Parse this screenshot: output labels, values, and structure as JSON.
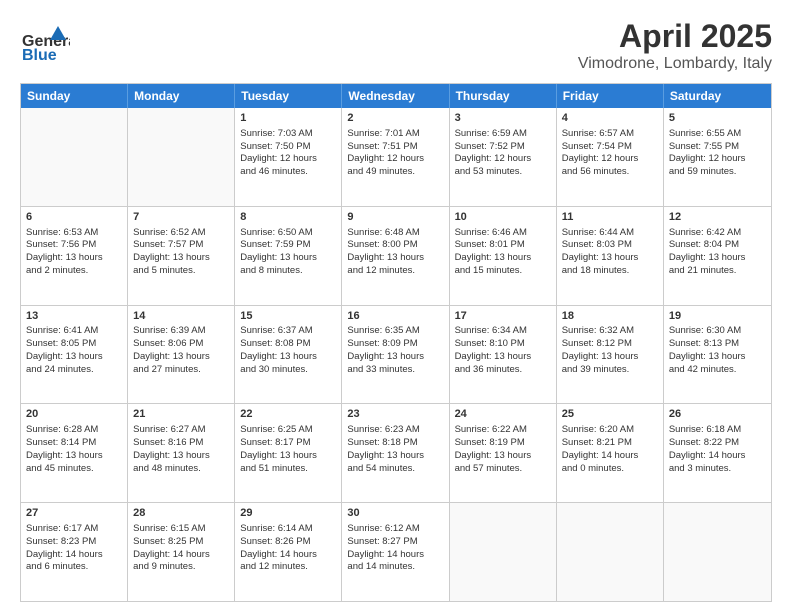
{
  "header": {
    "logo_line1": "General",
    "logo_line2": "Blue",
    "title": "April 2025",
    "subtitle": "Vimodrone, Lombardy, Italy"
  },
  "days_of_week": [
    "Sunday",
    "Monday",
    "Tuesday",
    "Wednesday",
    "Thursday",
    "Friday",
    "Saturday"
  ],
  "weeks": [
    [
      {
        "day": "",
        "lines": []
      },
      {
        "day": "",
        "lines": []
      },
      {
        "day": "1",
        "lines": [
          "Sunrise: 7:03 AM",
          "Sunset: 7:50 PM",
          "Daylight: 12 hours",
          "and 46 minutes."
        ]
      },
      {
        "day": "2",
        "lines": [
          "Sunrise: 7:01 AM",
          "Sunset: 7:51 PM",
          "Daylight: 12 hours",
          "and 49 minutes."
        ]
      },
      {
        "day": "3",
        "lines": [
          "Sunrise: 6:59 AM",
          "Sunset: 7:52 PM",
          "Daylight: 12 hours",
          "and 53 minutes."
        ]
      },
      {
        "day": "4",
        "lines": [
          "Sunrise: 6:57 AM",
          "Sunset: 7:54 PM",
          "Daylight: 12 hours",
          "and 56 minutes."
        ]
      },
      {
        "day": "5",
        "lines": [
          "Sunrise: 6:55 AM",
          "Sunset: 7:55 PM",
          "Daylight: 12 hours",
          "and 59 minutes."
        ]
      }
    ],
    [
      {
        "day": "6",
        "lines": [
          "Sunrise: 6:53 AM",
          "Sunset: 7:56 PM",
          "Daylight: 13 hours",
          "and 2 minutes."
        ]
      },
      {
        "day": "7",
        "lines": [
          "Sunrise: 6:52 AM",
          "Sunset: 7:57 PM",
          "Daylight: 13 hours",
          "and 5 minutes."
        ]
      },
      {
        "day": "8",
        "lines": [
          "Sunrise: 6:50 AM",
          "Sunset: 7:59 PM",
          "Daylight: 13 hours",
          "and 8 minutes."
        ]
      },
      {
        "day": "9",
        "lines": [
          "Sunrise: 6:48 AM",
          "Sunset: 8:00 PM",
          "Daylight: 13 hours",
          "and 12 minutes."
        ]
      },
      {
        "day": "10",
        "lines": [
          "Sunrise: 6:46 AM",
          "Sunset: 8:01 PM",
          "Daylight: 13 hours",
          "and 15 minutes."
        ]
      },
      {
        "day": "11",
        "lines": [
          "Sunrise: 6:44 AM",
          "Sunset: 8:03 PM",
          "Daylight: 13 hours",
          "and 18 minutes."
        ]
      },
      {
        "day": "12",
        "lines": [
          "Sunrise: 6:42 AM",
          "Sunset: 8:04 PM",
          "Daylight: 13 hours",
          "and 21 minutes."
        ]
      }
    ],
    [
      {
        "day": "13",
        "lines": [
          "Sunrise: 6:41 AM",
          "Sunset: 8:05 PM",
          "Daylight: 13 hours",
          "and 24 minutes."
        ]
      },
      {
        "day": "14",
        "lines": [
          "Sunrise: 6:39 AM",
          "Sunset: 8:06 PM",
          "Daylight: 13 hours",
          "and 27 minutes."
        ]
      },
      {
        "day": "15",
        "lines": [
          "Sunrise: 6:37 AM",
          "Sunset: 8:08 PM",
          "Daylight: 13 hours",
          "and 30 minutes."
        ]
      },
      {
        "day": "16",
        "lines": [
          "Sunrise: 6:35 AM",
          "Sunset: 8:09 PM",
          "Daylight: 13 hours",
          "and 33 minutes."
        ]
      },
      {
        "day": "17",
        "lines": [
          "Sunrise: 6:34 AM",
          "Sunset: 8:10 PM",
          "Daylight: 13 hours",
          "and 36 minutes."
        ]
      },
      {
        "day": "18",
        "lines": [
          "Sunrise: 6:32 AM",
          "Sunset: 8:12 PM",
          "Daylight: 13 hours",
          "and 39 minutes."
        ]
      },
      {
        "day": "19",
        "lines": [
          "Sunrise: 6:30 AM",
          "Sunset: 8:13 PM",
          "Daylight: 13 hours",
          "and 42 minutes."
        ]
      }
    ],
    [
      {
        "day": "20",
        "lines": [
          "Sunrise: 6:28 AM",
          "Sunset: 8:14 PM",
          "Daylight: 13 hours",
          "and 45 minutes."
        ]
      },
      {
        "day": "21",
        "lines": [
          "Sunrise: 6:27 AM",
          "Sunset: 8:16 PM",
          "Daylight: 13 hours",
          "and 48 minutes."
        ]
      },
      {
        "day": "22",
        "lines": [
          "Sunrise: 6:25 AM",
          "Sunset: 8:17 PM",
          "Daylight: 13 hours",
          "and 51 minutes."
        ]
      },
      {
        "day": "23",
        "lines": [
          "Sunrise: 6:23 AM",
          "Sunset: 8:18 PM",
          "Daylight: 13 hours",
          "and 54 minutes."
        ]
      },
      {
        "day": "24",
        "lines": [
          "Sunrise: 6:22 AM",
          "Sunset: 8:19 PM",
          "Daylight: 13 hours",
          "and 57 minutes."
        ]
      },
      {
        "day": "25",
        "lines": [
          "Sunrise: 6:20 AM",
          "Sunset: 8:21 PM",
          "Daylight: 14 hours",
          "and 0 minutes."
        ]
      },
      {
        "day": "26",
        "lines": [
          "Sunrise: 6:18 AM",
          "Sunset: 8:22 PM",
          "Daylight: 14 hours",
          "and 3 minutes."
        ]
      }
    ],
    [
      {
        "day": "27",
        "lines": [
          "Sunrise: 6:17 AM",
          "Sunset: 8:23 PM",
          "Daylight: 14 hours",
          "and 6 minutes."
        ]
      },
      {
        "day": "28",
        "lines": [
          "Sunrise: 6:15 AM",
          "Sunset: 8:25 PM",
          "Daylight: 14 hours",
          "and 9 minutes."
        ]
      },
      {
        "day": "29",
        "lines": [
          "Sunrise: 6:14 AM",
          "Sunset: 8:26 PM",
          "Daylight: 14 hours",
          "and 12 minutes."
        ]
      },
      {
        "day": "30",
        "lines": [
          "Sunrise: 6:12 AM",
          "Sunset: 8:27 PM",
          "Daylight: 14 hours",
          "and 14 minutes."
        ]
      },
      {
        "day": "",
        "lines": []
      },
      {
        "day": "",
        "lines": []
      },
      {
        "day": "",
        "lines": []
      }
    ]
  ]
}
